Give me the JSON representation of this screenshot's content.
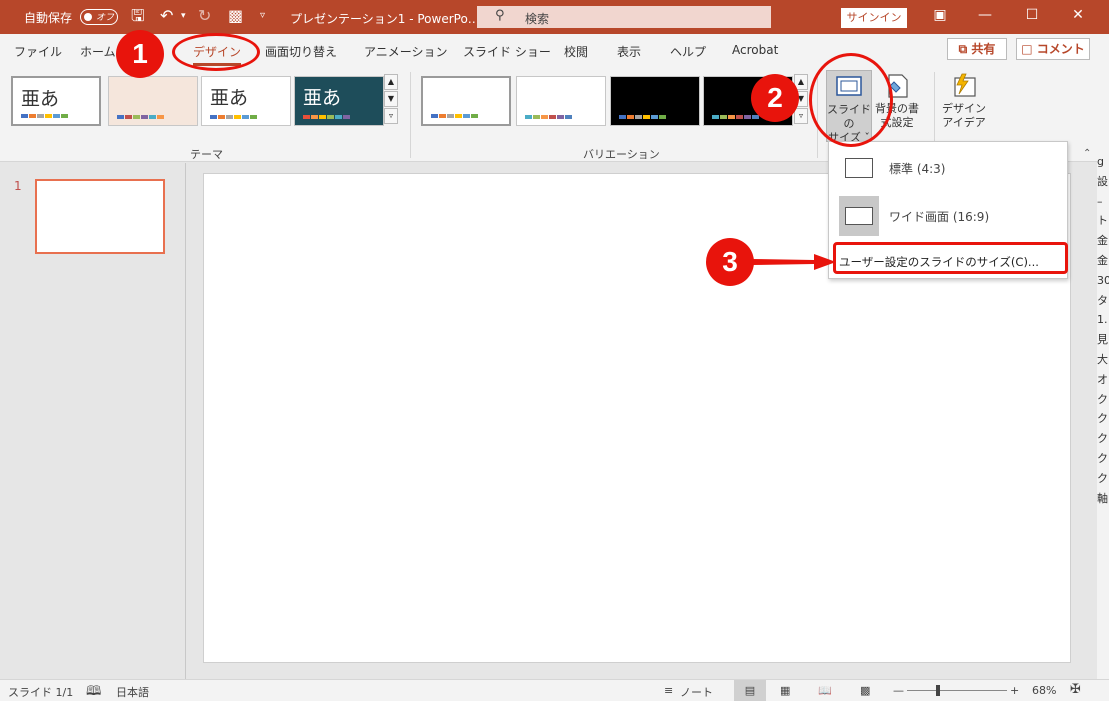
{
  "titlebar": {
    "autosave_label": "自動保存",
    "toggle_label": "オフ",
    "doc_title": "プレゼンテーション1 - PowerPo…",
    "search_placeholder": "検索",
    "signin_label": "サインイン"
  },
  "tabs": [
    {
      "label": "ファイル"
    },
    {
      "label": "ホーム"
    },
    {
      "label": "デザイン"
    },
    {
      "label": "画面切り替え"
    },
    {
      "label": "アニメーション"
    },
    {
      "label": "スライド ショー"
    },
    {
      "label": "校閲"
    },
    {
      "label": "表示"
    },
    {
      "label": "ヘルプ"
    },
    {
      "label": "Acrobat"
    }
  ],
  "active_tab": "デザイン",
  "share_label": "共有",
  "comment_label": "コメント",
  "themes": {
    "group_label": "テーマ",
    "items": [
      {
        "text": "亜あ",
        "bg": "#ffffff",
        "text_color": "#333333"
      },
      {
        "text": "",
        "bg": "#f5e6dc",
        "text_color": "#333333"
      },
      {
        "text": "亜あ",
        "bg": "#ffffff",
        "text_color": "#333333"
      },
      {
        "text": "亜あ",
        "bg": "#1e4d5a",
        "text_color": "#ffffff"
      }
    ]
  },
  "variations": {
    "group_label": "バリエーション",
    "items": [
      {
        "bg": "#ffffff"
      },
      {
        "bg": "#ffffff"
      },
      {
        "bg": "#000000"
      },
      {
        "bg": "#000000"
      }
    ]
  },
  "slide_size_button": {
    "line1": "スライドの",
    "line2": "サイズ ˇ"
  },
  "bg_format_button": {
    "line1": "背景の書",
    "line2": "式設定"
  },
  "design_ideas_button": {
    "line1": "デザイン",
    "line2": "アイデア"
  },
  "dropdown": {
    "items": [
      {
        "label": "標準 (4:3)"
      },
      {
        "label": "ワイド画面 (16:9)"
      },
      {
        "label": "ユーザー設定のスライドのサイズ(C)..."
      }
    ]
  },
  "slide_panel": {
    "slide_number": "1"
  },
  "right_strip": [
    "g",
    "設",
    "–",
    "ト",
    "金",
    "金",
    "30",
    "タ",
    "1.",
    "見",
    "大",
    "オ",
    "ク",
    "ク",
    "ク",
    "ク",
    "ク",
    "軸"
  ],
  "statusbar": {
    "slide_info": "スライド 1/1",
    "language": "日本語",
    "notes_label": "ノート",
    "zoom": "68%"
  },
  "annotations": {
    "step1": "1",
    "step2": "2",
    "step3": "3",
    "color": "#e8140c"
  }
}
